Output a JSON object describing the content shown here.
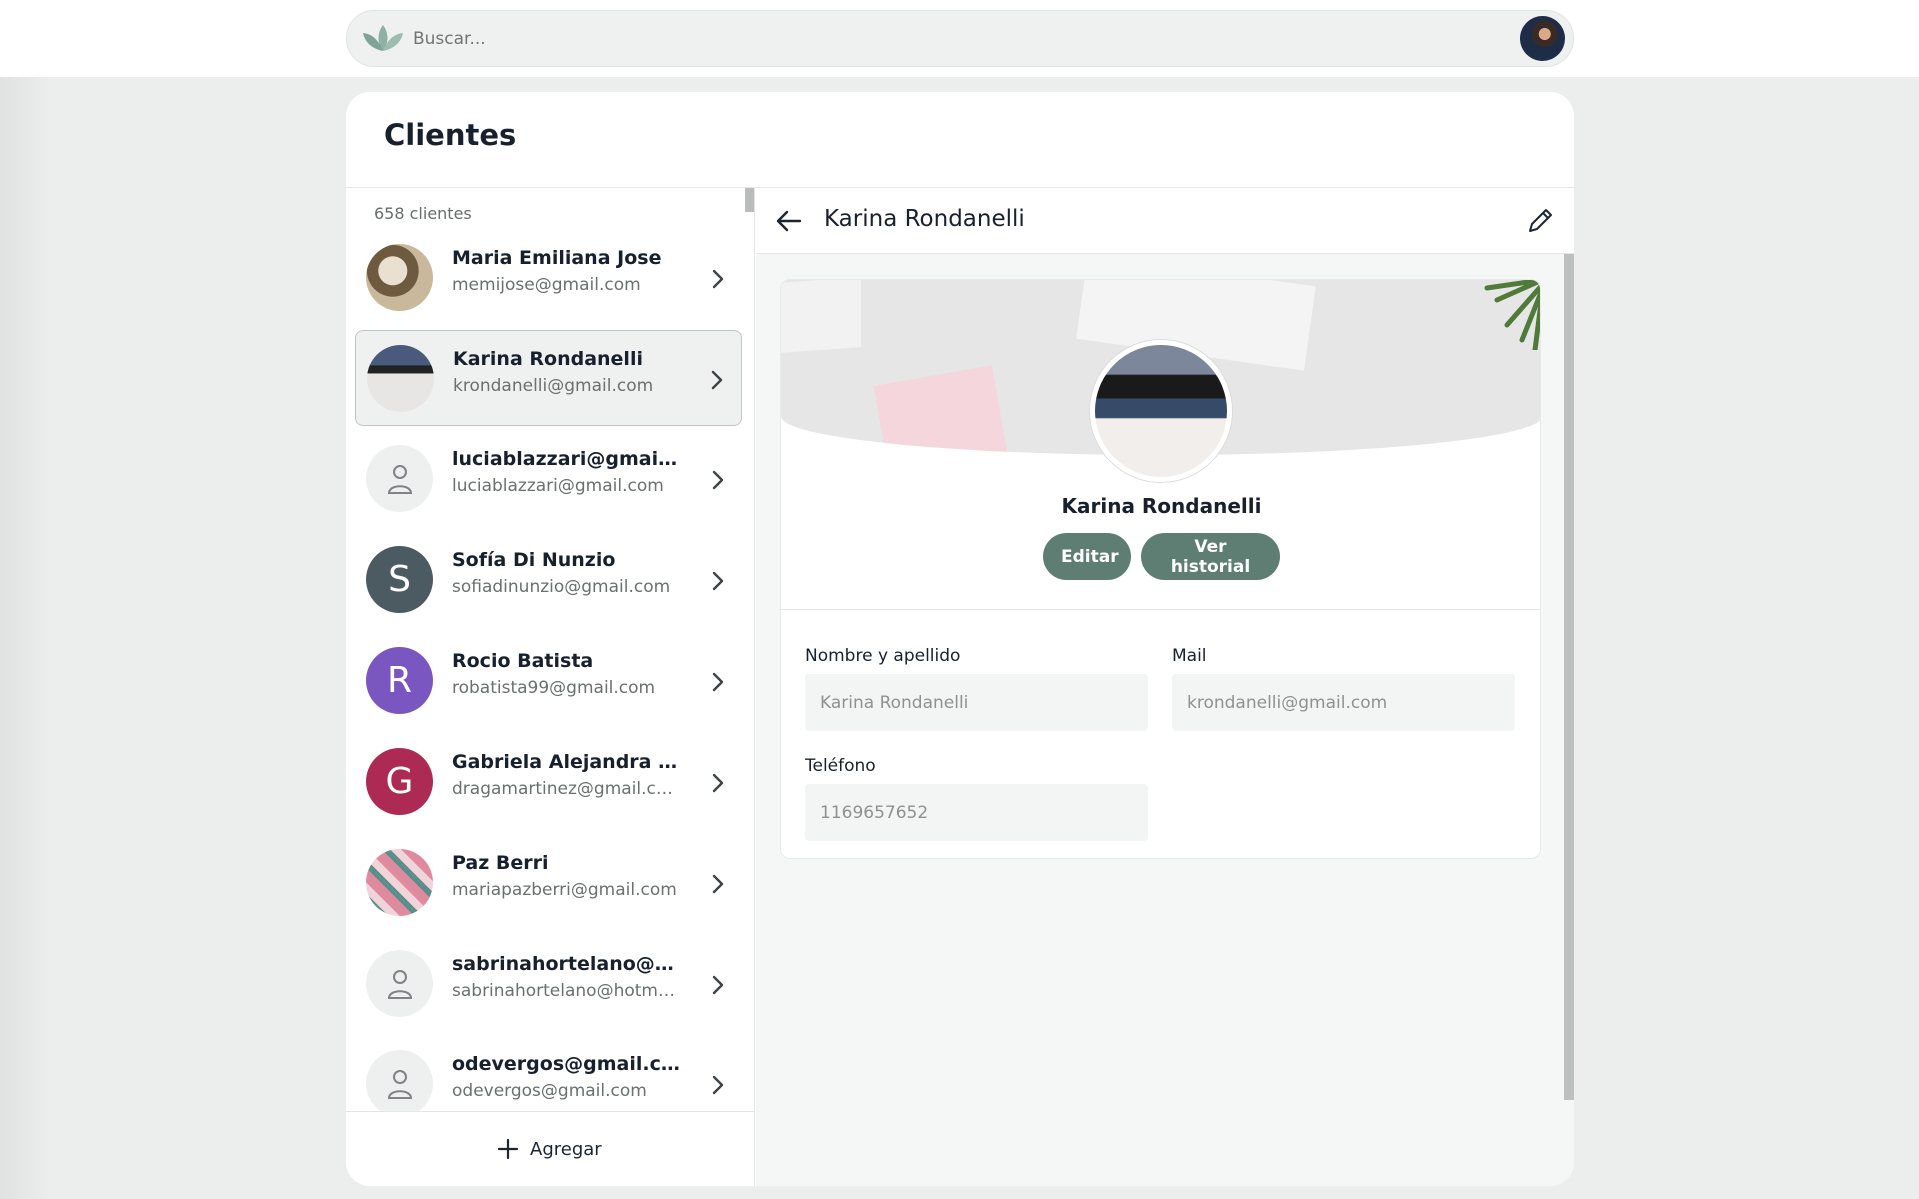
{
  "search": {
    "placeholder": "Buscar..."
  },
  "page": {
    "title": "Clientes"
  },
  "list": {
    "count_label": "658 clientes",
    "items": [
      {
        "name": "Maria Emiliana Jose",
        "email": "memijose@gmail.com",
        "avatar": "photo"
      },
      {
        "name": "Karina Rondanelli",
        "email": "krondanelli@gmail.com",
        "avatar": "photo",
        "selected": true
      },
      {
        "name": "luciablazzari@gmail.com",
        "email": "luciablazzari@gmail.com",
        "avatar": "user-icon"
      },
      {
        "name": "Sofía Di Nunzio",
        "email": "sofiadinunzio@gmail.com",
        "avatar": "S",
        "color": "#4c5a62"
      },
      {
        "name": "Rocio Batista",
        "email": "robatista99@gmail.com",
        "avatar": "R",
        "color": "#7a56c0"
      },
      {
        "name": "Gabriela Alejandra Martinez",
        "email": "dragamartinez@gmail.com",
        "avatar": "G",
        "color": "#ad2a55"
      },
      {
        "name": "Paz Berri",
        "email": "mariapazberri@gmail.com",
        "avatar": "photo"
      },
      {
        "name": "sabrinahortelano@hotmail.com",
        "email": "sabrinahortelano@hotmail.com",
        "avatar": "user-icon"
      },
      {
        "name": "odevergos@gmail.com",
        "email": "odevergos@gmail.com",
        "avatar": "user-icon"
      }
    ],
    "add_label": "Agregar"
  },
  "detail": {
    "title": "Karina Rondanelli",
    "profile_name": "Karina Rondanelli",
    "edit_label": "Editar",
    "history_label": "Ver historial",
    "fields": {
      "name_label": "Nombre y apellido",
      "name_value": "Karina Rondanelli",
      "mail_label": "Mail",
      "mail_value": "krondanelli@gmail.com",
      "phone_label": "Teléfono",
      "phone_value": "1169657652"
    }
  },
  "colors": {
    "accent": "#5e7e73",
    "selected_bg": "#eff1f0",
    "text": "#17202c"
  },
  "icons": [
    "lotus-logo-icon",
    "user-icon",
    "chevron-right-icon",
    "plus-icon",
    "arrow-left-icon",
    "pencil-icon"
  ]
}
